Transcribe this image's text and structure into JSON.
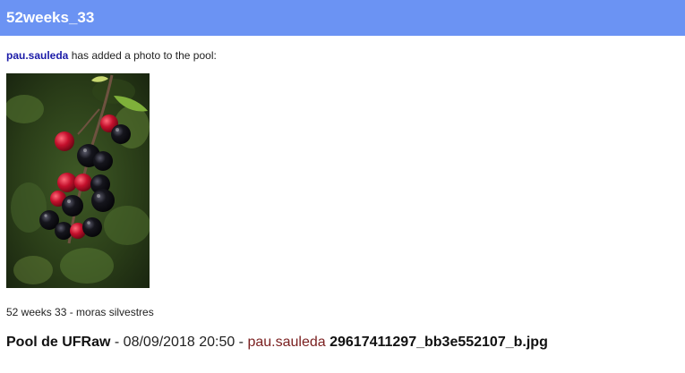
{
  "header": {
    "title": "52weeks_33"
  },
  "intro": {
    "user": "pau.sauleda",
    "text": " has added a photo to the pool:"
  },
  "photo": {
    "icon": "blackberry-branch-photo"
  },
  "caption": "52 weeks 33 - moras silvestres",
  "footer": {
    "pool": "Pool de UFRaw",
    "sep1": " - ",
    "datetime": "08/09/2018 20:50",
    "sep2": " - ",
    "author": "pau.sauleda",
    "filename": "29617411297_bb3e552107_b.jpg"
  }
}
